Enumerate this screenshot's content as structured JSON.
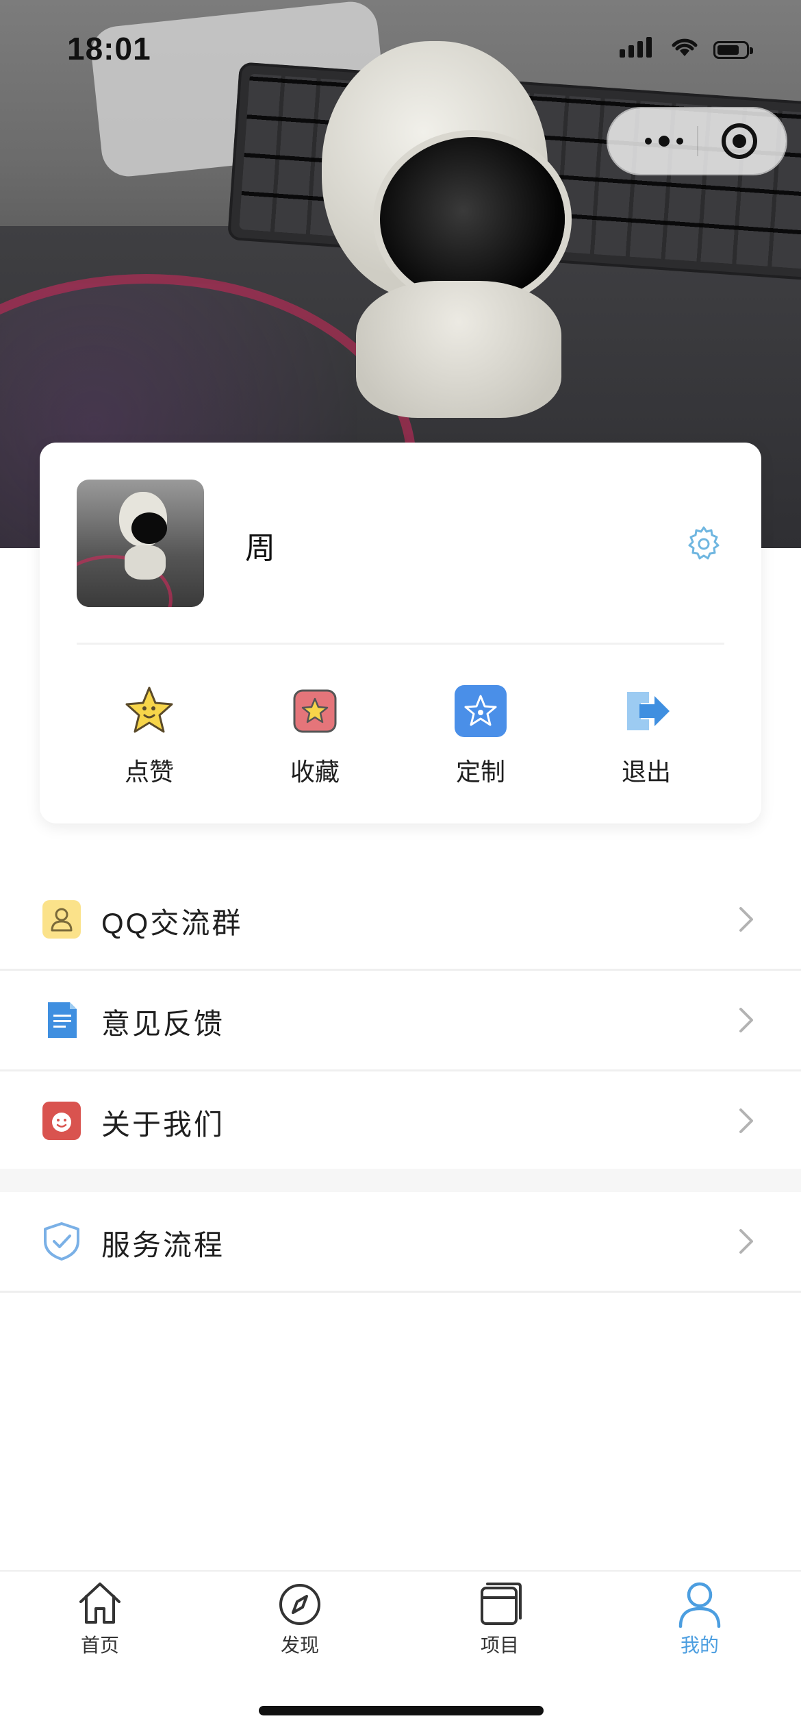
{
  "status_bar": {
    "time": "18:01"
  },
  "profile": {
    "name": "周"
  },
  "actions": [
    {
      "label": "点赞",
      "icon": "thumbs-up-star-icon"
    },
    {
      "label": "收藏",
      "icon": "favorite-star-icon"
    },
    {
      "label": "定制",
      "icon": "custom-star-icon"
    },
    {
      "label": "退出",
      "icon": "logout-icon"
    }
  ],
  "menu": [
    {
      "label": "QQ交流群",
      "icon": "qq-group-icon"
    },
    {
      "label": "意见反馈",
      "icon": "feedback-document-icon"
    },
    {
      "label": "关于我们",
      "icon": "about-us-icon"
    },
    {
      "label": "服务流程",
      "icon": "shield-check-icon"
    }
  ],
  "tabbar": [
    {
      "label": "首页",
      "icon": "home-icon",
      "active": false
    },
    {
      "label": "发现",
      "icon": "compass-icon",
      "active": false
    },
    {
      "label": "项目",
      "icon": "projects-icon",
      "active": false
    },
    {
      "label": "我的",
      "icon": "user-icon",
      "active": true
    }
  ],
  "colors": {
    "accent": "#4c9ee0",
    "gold": "#f5c518",
    "red": "#d9534f",
    "blue": "#4a8fe8"
  }
}
